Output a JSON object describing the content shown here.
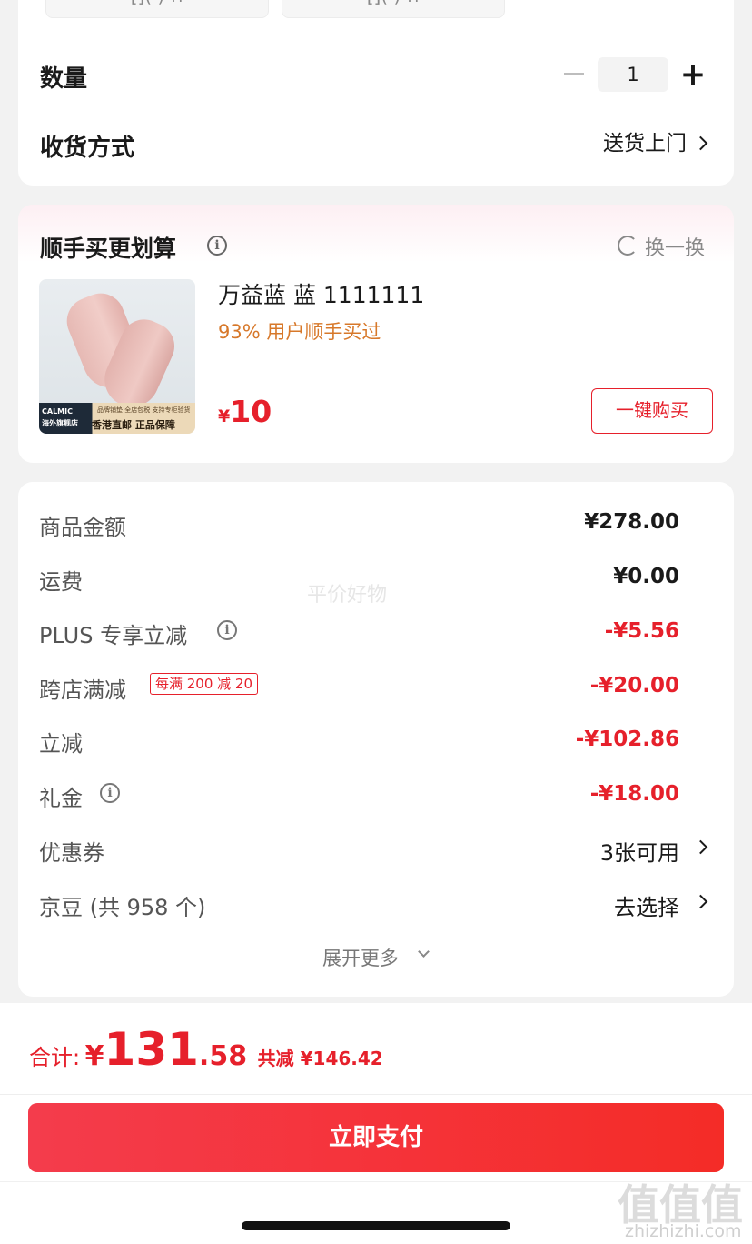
{
  "top_card": {
    "spec_chip_a": "[]( ) ∩",
    "spec_chip_b": "[]( ) ∩",
    "quantity_label": "数量",
    "quantity_value": "1",
    "delivery_label": "收货方式",
    "delivery_value": "送货上门"
  },
  "recommend": {
    "title": "顺手买更划算",
    "swap_label": "换一换",
    "image": {
      "brand": "CALMIC",
      "brand_sub": "海外旗舰店",
      "tag_small": "品牌铺垫 全店包税 支持专柜验货",
      "tag_big": "香港直邮 正品保障"
    },
    "product_name": "万益蓝 蓝 1111111",
    "product_sub": "93% 用户顺手买过",
    "price_currency": "¥",
    "price_value": "10",
    "buy_label": "一键购买"
  },
  "price_breakdown": {
    "watermark": "平价好物",
    "rows": [
      {
        "label": "商品金额",
        "value": "¥278.00"
      },
      {
        "label": "运费",
        "value": "¥0.00"
      },
      {
        "label": "PLUS 专享立减",
        "value": "-¥5.56"
      },
      {
        "label": "跨店满减",
        "value": "-¥20.00",
        "badge": "每满 200 减 20"
      },
      {
        "label": "立减",
        "value": "-¥102.86"
      },
      {
        "label": "礼金",
        "value": "-¥18.00"
      },
      {
        "label": "优惠券",
        "value": "3张可用"
      },
      {
        "label": "京豆 (共 958 个)",
        "value": "去选择"
      }
    ],
    "expand_label": "展开更多"
  },
  "bottom_bar": {
    "total_label": "合计:",
    "total_currency": "¥",
    "total_int": "131",
    "total_dec": ".58",
    "saved_text": "共减 ¥146.42",
    "pay_label": "立即支付"
  },
  "watermark": {
    "logo": "值值值",
    "url": "zhizhizhi.com"
  },
  "colors": {
    "accent_red": "#e6202b",
    "orange_sub": "#d7782a",
    "page_bg": "#f2f2f2"
  },
  "icons": [
    "minus-icon",
    "plus-icon",
    "chevron-right-icon",
    "info-icon",
    "refresh-icon",
    "chevron-down-icon"
  ]
}
